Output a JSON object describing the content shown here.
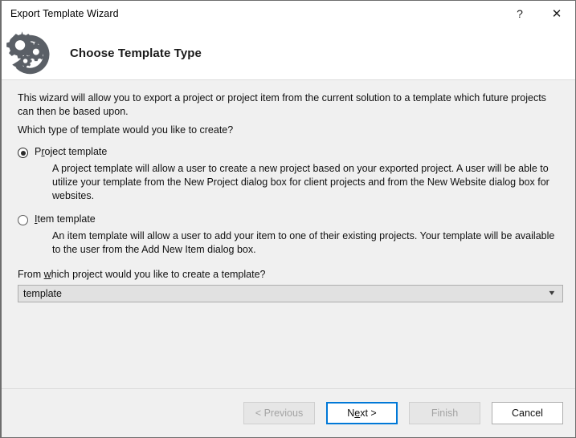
{
  "window": {
    "title": "Export Template Wizard",
    "help_icon": "?",
    "close_icon": "✕",
    "accent_color": "#0078d7",
    "header_icon": "export-gears-icon"
  },
  "header": {
    "title": "Choose Template Type"
  },
  "body": {
    "intro": "This wizard will allow you to export a project or project item from the current solution to a template which future projects can then be based upon.",
    "question": "Which type of template would you like to create?",
    "options": [
      {
        "label_before": "P",
        "label_mnemonic": "r",
        "label_after": "oject template",
        "label_full": "Project template",
        "selected": true,
        "description": "A project template will allow a user to create a new project based on your exported project. A user will be able to utilize your template from the New Project dialog box for client projects and from the New Website dialog box for websites."
      },
      {
        "label_before": "",
        "label_mnemonic": "I",
        "label_after": "tem template",
        "label_full": "Item template",
        "selected": false,
        "description": "An item template will allow a user to add your item to one of their existing projects. Your template will be available to the user from the Add New Item dialog box."
      }
    ],
    "project_label_before": "From ",
    "project_label_mnemonic": "w",
    "project_label_after": "hich project would you like to create a template?",
    "project_select": {
      "value": "template",
      "arrow_icon": "chevron-down-icon"
    }
  },
  "footer": {
    "previous": {
      "label": "< Previous",
      "disabled": true
    },
    "next": {
      "label_before": "N",
      "label_mnemonic": "e",
      "label_after": "xt >",
      "disabled": false,
      "default": true
    },
    "finish": {
      "label": "Finish",
      "disabled": true
    },
    "cancel": {
      "label": "Cancel",
      "disabled": false
    }
  }
}
